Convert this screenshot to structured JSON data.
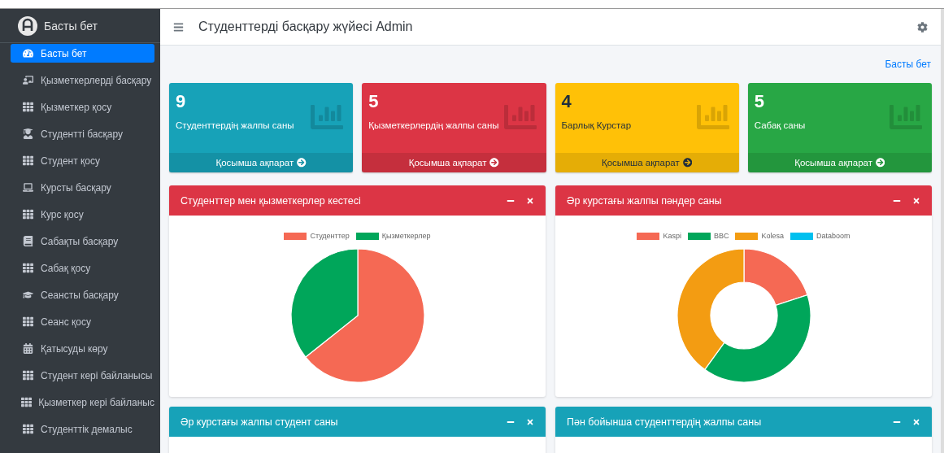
{
  "sidebar": {
    "brand": "Басты бет",
    "items": [
      {
        "label": "Басты бет",
        "selected": true
      },
      {
        "label": "Қызметкерлерді басқару",
        "selected": false
      },
      {
        "label": "Қызметкер қосу",
        "selected": false
      },
      {
        "label": "Студентті басқару",
        "selected": false
      },
      {
        "label": "Студент қосу",
        "selected": false
      },
      {
        "label": "Курсты басқару",
        "selected": false
      },
      {
        "label": "Курс қосу",
        "selected": false
      },
      {
        "label": "Сабақты басқару",
        "selected": false
      },
      {
        "label": "Сабақ қосу",
        "selected": false
      },
      {
        "label": "Сеансты басқару",
        "selected": false
      },
      {
        "label": "Сеанс қосу",
        "selected": false
      },
      {
        "label": "Қатысуды көру",
        "selected": false
      },
      {
        "label": "Студент кері байланысы",
        "selected": false
      },
      {
        "label": "Қызметкер кері байланыс",
        "selected": false
      },
      {
        "label": "Студенттік демалыс",
        "selected": false
      }
    ]
  },
  "header": {
    "title": "Студенттерді басқару жүйесі Admin"
  },
  "breadcrumb": "Басты бет",
  "stat_cards": [
    {
      "value": "9",
      "label": "Студенттердің жалпы саны",
      "link": "Қосымша ақпарат",
      "color": "#17a2b8"
    },
    {
      "value": "5",
      "label": "Қызметкерлердің жалпы саны",
      "link": "Қосымша ақпарат",
      "color": "#dc3545"
    },
    {
      "value": "4",
      "label": "Барлық Курстар",
      "link": "Қосымша ақпарат",
      "color": "#ffc107"
    },
    {
      "value": "5",
      "label": "Сабақ саны",
      "link": "Қосымша ақпарат",
      "color": "#28a745"
    }
  ],
  "panels": [
    {
      "title": "Студенттер мен қызметкерлер кестесі",
      "color": "#dc3545",
      "chart_data": {
        "type": "pie",
        "legend": "top",
        "categories": [
          "Студенттер",
          "Қызметкерлер"
        ],
        "series": [
          {
            "colors": [
              "#f56954",
              "#00a65a"
            ],
            "values": [
              64.3,
              35.7
            ]
          }
        ]
      }
    },
    {
      "title": "Әр курстағы жалпы пәндер саны",
      "color": "#dc3545",
      "chart_data": {
        "type": "donut",
        "legend": "top",
        "categories": [
          "Kaspi",
          "BBC",
          "Kolesa",
          "Databoom"
        ],
        "series": [
          {
            "colors": [
              "#f56954",
              "#00a65a",
              "#f39c12",
              "#00c0ef"
            ],
            "values": [
              20,
              40,
              40,
              0
            ]
          }
        ]
      }
    },
    {
      "title": "Әр курстағы жалпы студент саны",
      "color": "#17a2b8"
    },
    {
      "title": "Пән бойынша студенттердің жалпы саны",
      "color": "#17a2b8"
    }
  ]
}
